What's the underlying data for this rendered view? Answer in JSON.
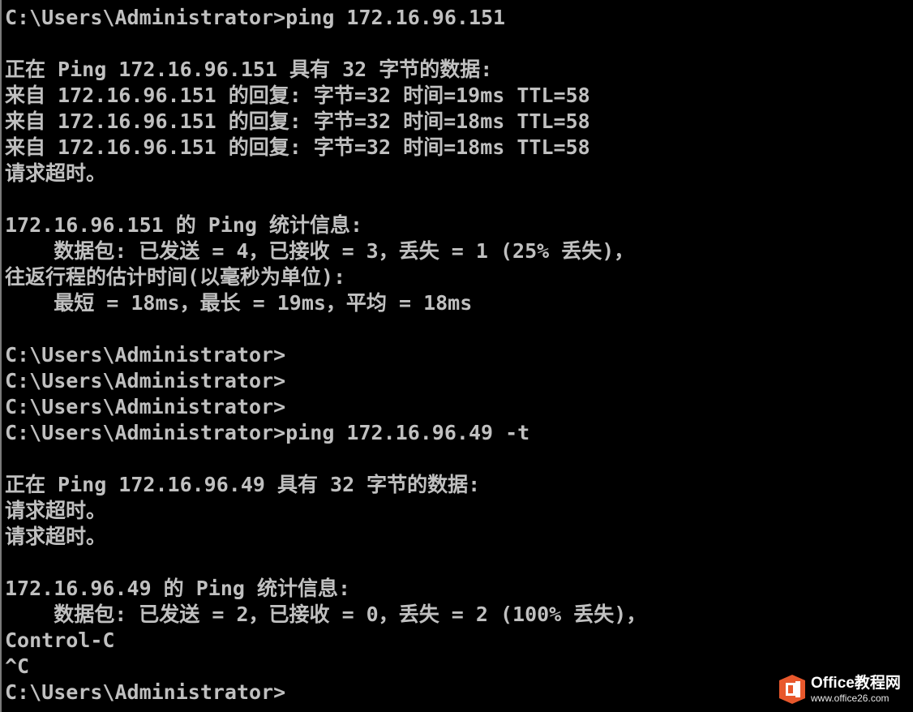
{
  "console": {
    "lines": [
      "C:\\Users\\Administrator>ping 172.16.96.151",
      "",
      "正在 Ping 172.16.96.151 具有 32 字节的数据:",
      "来自 172.16.96.151 的回复: 字节=32 时间=19ms TTL=58",
      "来自 172.16.96.151 的回复: 字节=32 时间=18ms TTL=58",
      "来自 172.16.96.151 的回复: 字节=32 时间=18ms TTL=58",
      "请求超时。",
      "",
      "172.16.96.151 的 Ping 统计信息:",
      "    数据包: 已发送 = 4，已接收 = 3，丢失 = 1 (25% 丢失)，",
      "往返行程的估计时间(以毫秒为单位):",
      "    最短 = 18ms，最长 = 19ms，平均 = 18ms",
      "",
      "C:\\Users\\Administrator>",
      "C:\\Users\\Administrator>",
      "C:\\Users\\Administrator>",
      "C:\\Users\\Administrator>ping 172.16.96.49 -t",
      "",
      "正在 Ping 172.16.96.49 具有 32 字节的数据:",
      "请求超时。",
      "请求超时。",
      "",
      "172.16.96.49 的 Ping 统计信息:",
      "    数据包: 已发送 = 2，已接收 = 0，丢失 = 2 (100% 丢失)，",
      "Control-C",
      "^C",
      "C:\\Users\\Administrator>"
    ]
  },
  "watermark": {
    "title": "Office教程网",
    "url": "www.office26.com",
    "logo_icon": "office-logo-icon",
    "logo_color": "#e8582c"
  },
  "colors": {
    "background": "#000000",
    "text": "#c0c0c0"
  }
}
